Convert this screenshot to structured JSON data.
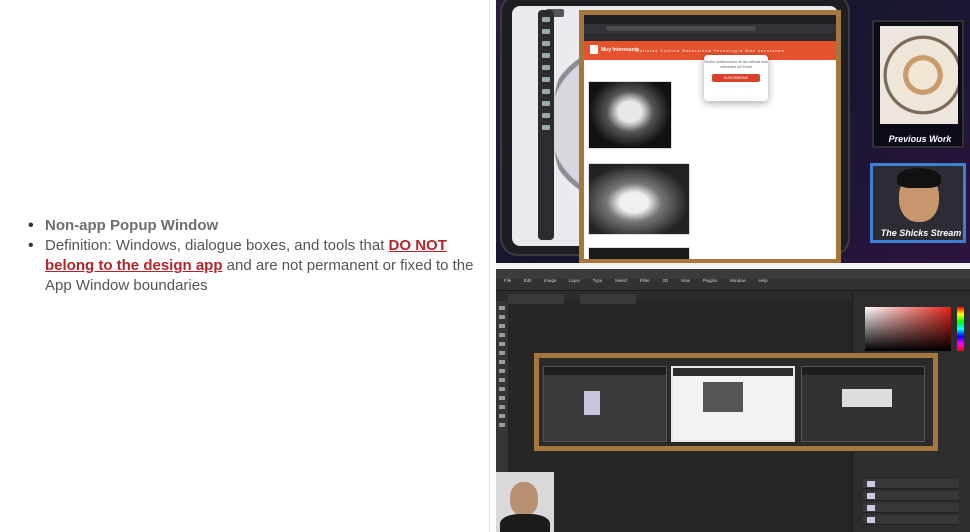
{
  "bullets": {
    "title": "Non-app Popup Window",
    "definition_prefix": "Definition: Windows, dialogue boxes, and tools that ",
    "definition_emphasis": "DO NOT belong to the design app",
    "definition_suffix": " and are not permanent or fixed to the App Window boundaries"
  },
  "stream_top": {
    "browser_tab": "Fotografía de fantasmas",
    "site_logo": "Muy Interesante",
    "site_nav": "Noticias  Cultura  Naturaleza  Tecnología  Más secciones",
    "popup_text": "Recibir notificaciones de las noticias más relevantes del Portal",
    "popup_button": "SUSCRIBIRME",
    "art_caption": "Previous Work",
    "cam_caption": "The Shicks Stream"
  },
  "stream_bottom": {
    "menu": [
      "File",
      "Edit",
      "Image",
      "Layer",
      "Type",
      "Select",
      "Filter",
      "3D",
      "View",
      "Plugins",
      "Window",
      "Help"
    ]
  }
}
